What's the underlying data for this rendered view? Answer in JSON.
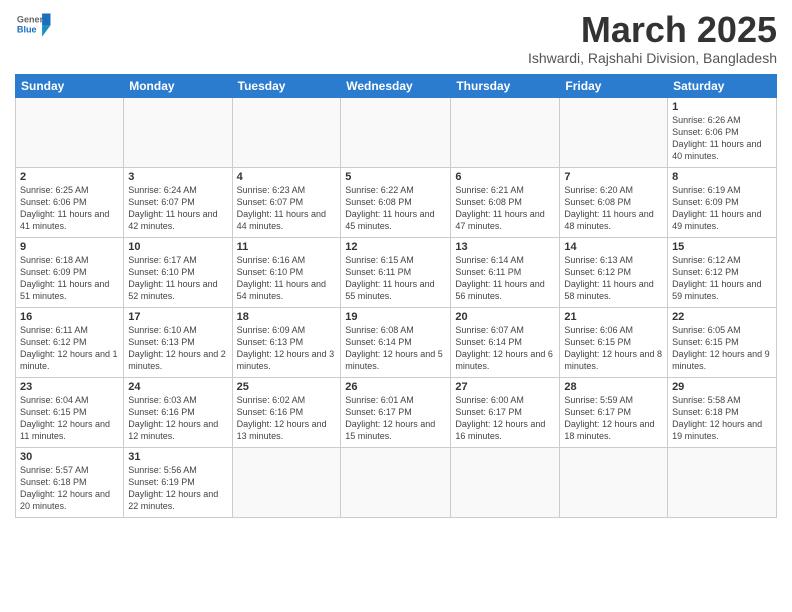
{
  "header": {
    "logo_general": "General",
    "logo_blue": "Blue",
    "title": "March 2025",
    "subtitle": "Ishwardi, Rajshahi Division, Bangladesh"
  },
  "weekdays": [
    "Sunday",
    "Monday",
    "Tuesday",
    "Wednesday",
    "Thursday",
    "Friday",
    "Saturday"
  ],
  "weeks": [
    [
      {
        "day": "",
        "info": ""
      },
      {
        "day": "",
        "info": ""
      },
      {
        "day": "",
        "info": ""
      },
      {
        "day": "",
        "info": ""
      },
      {
        "day": "",
        "info": ""
      },
      {
        "day": "",
        "info": ""
      },
      {
        "day": "1",
        "info": "Sunrise: 6:26 AM\nSunset: 6:06 PM\nDaylight: 11 hours\nand 40 minutes."
      }
    ],
    [
      {
        "day": "2",
        "info": "Sunrise: 6:25 AM\nSunset: 6:06 PM\nDaylight: 11 hours\nand 41 minutes."
      },
      {
        "day": "3",
        "info": "Sunrise: 6:24 AM\nSunset: 6:07 PM\nDaylight: 11 hours\nand 42 minutes."
      },
      {
        "day": "4",
        "info": "Sunrise: 6:23 AM\nSunset: 6:07 PM\nDaylight: 11 hours\nand 44 minutes."
      },
      {
        "day": "5",
        "info": "Sunrise: 6:22 AM\nSunset: 6:08 PM\nDaylight: 11 hours\nand 45 minutes."
      },
      {
        "day": "6",
        "info": "Sunrise: 6:21 AM\nSunset: 6:08 PM\nDaylight: 11 hours\nand 47 minutes."
      },
      {
        "day": "7",
        "info": "Sunrise: 6:20 AM\nSunset: 6:08 PM\nDaylight: 11 hours\nand 48 minutes."
      },
      {
        "day": "8",
        "info": "Sunrise: 6:19 AM\nSunset: 6:09 PM\nDaylight: 11 hours\nand 49 minutes."
      }
    ],
    [
      {
        "day": "9",
        "info": "Sunrise: 6:18 AM\nSunset: 6:09 PM\nDaylight: 11 hours\nand 51 minutes."
      },
      {
        "day": "10",
        "info": "Sunrise: 6:17 AM\nSunset: 6:10 PM\nDaylight: 11 hours\nand 52 minutes."
      },
      {
        "day": "11",
        "info": "Sunrise: 6:16 AM\nSunset: 6:10 PM\nDaylight: 11 hours\nand 54 minutes."
      },
      {
        "day": "12",
        "info": "Sunrise: 6:15 AM\nSunset: 6:11 PM\nDaylight: 11 hours\nand 55 minutes."
      },
      {
        "day": "13",
        "info": "Sunrise: 6:14 AM\nSunset: 6:11 PM\nDaylight: 11 hours\nand 56 minutes."
      },
      {
        "day": "14",
        "info": "Sunrise: 6:13 AM\nSunset: 6:12 PM\nDaylight: 11 hours\nand 58 minutes."
      },
      {
        "day": "15",
        "info": "Sunrise: 6:12 AM\nSunset: 6:12 PM\nDaylight: 11 hours\nand 59 minutes."
      }
    ],
    [
      {
        "day": "16",
        "info": "Sunrise: 6:11 AM\nSunset: 6:12 PM\nDaylight: 12 hours\nand 1 minute."
      },
      {
        "day": "17",
        "info": "Sunrise: 6:10 AM\nSunset: 6:13 PM\nDaylight: 12 hours\nand 2 minutes."
      },
      {
        "day": "18",
        "info": "Sunrise: 6:09 AM\nSunset: 6:13 PM\nDaylight: 12 hours\nand 3 minutes."
      },
      {
        "day": "19",
        "info": "Sunrise: 6:08 AM\nSunset: 6:14 PM\nDaylight: 12 hours\nand 5 minutes."
      },
      {
        "day": "20",
        "info": "Sunrise: 6:07 AM\nSunset: 6:14 PM\nDaylight: 12 hours\nand 6 minutes."
      },
      {
        "day": "21",
        "info": "Sunrise: 6:06 AM\nSunset: 6:15 PM\nDaylight: 12 hours\nand 8 minutes."
      },
      {
        "day": "22",
        "info": "Sunrise: 6:05 AM\nSunset: 6:15 PM\nDaylight: 12 hours\nand 9 minutes."
      }
    ],
    [
      {
        "day": "23",
        "info": "Sunrise: 6:04 AM\nSunset: 6:15 PM\nDaylight: 12 hours\nand 11 minutes."
      },
      {
        "day": "24",
        "info": "Sunrise: 6:03 AM\nSunset: 6:16 PM\nDaylight: 12 hours\nand 12 minutes."
      },
      {
        "day": "25",
        "info": "Sunrise: 6:02 AM\nSunset: 6:16 PM\nDaylight: 12 hours\nand 13 minutes."
      },
      {
        "day": "26",
        "info": "Sunrise: 6:01 AM\nSunset: 6:17 PM\nDaylight: 12 hours\nand 15 minutes."
      },
      {
        "day": "27",
        "info": "Sunrise: 6:00 AM\nSunset: 6:17 PM\nDaylight: 12 hours\nand 16 minutes."
      },
      {
        "day": "28",
        "info": "Sunrise: 5:59 AM\nSunset: 6:17 PM\nDaylight: 12 hours\nand 18 minutes."
      },
      {
        "day": "29",
        "info": "Sunrise: 5:58 AM\nSunset: 6:18 PM\nDaylight: 12 hours\nand 19 minutes."
      }
    ],
    [
      {
        "day": "30",
        "info": "Sunrise: 5:57 AM\nSunset: 6:18 PM\nDaylight: 12 hours\nand 20 minutes."
      },
      {
        "day": "31",
        "info": "Sunrise: 5:56 AM\nSunset: 6:19 PM\nDaylight: 12 hours\nand 22 minutes."
      },
      {
        "day": "",
        "info": ""
      },
      {
        "day": "",
        "info": ""
      },
      {
        "day": "",
        "info": ""
      },
      {
        "day": "",
        "info": ""
      },
      {
        "day": "",
        "info": ""
      }
    ]
  ]
}
